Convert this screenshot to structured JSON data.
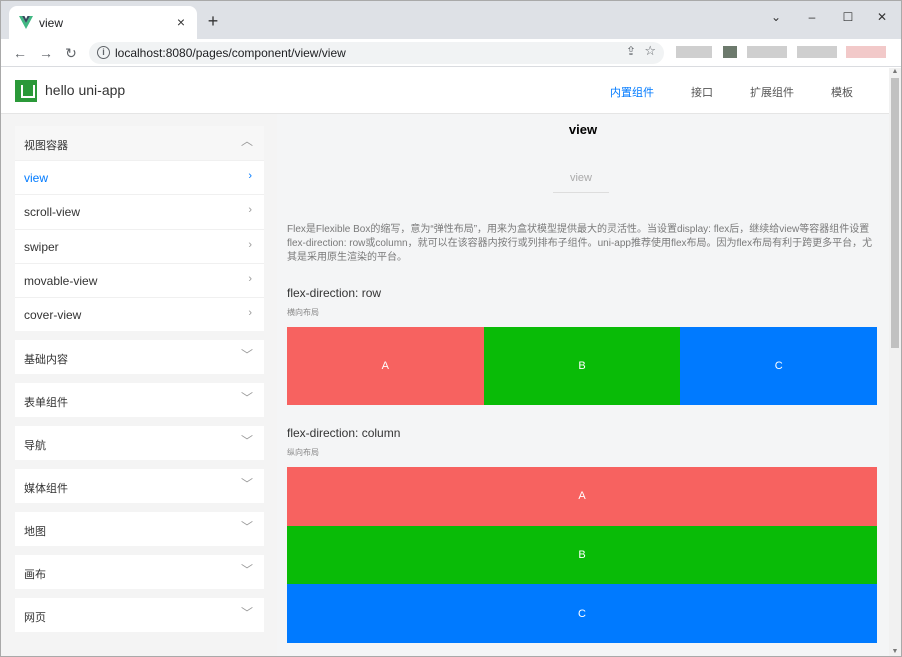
{
  "browser": {
    "tab_title": "view",
    "tab_close": "×",
    "new_tab": "+",
    "win_minimize": "–",
    "win_maximize": "☐",
    "win_close": "✕",
    "win_dropdown": "⌄",
    "url": "localhost:8080/pages/component/view/view",
    "back": "←",
    "forward": "→",
    "reload": "↻"
  },
  "app": {
    "title": "hello uni-app",
    "logo_color": "#2b9939",
    "nav": [
      {
        "label": "内置组件",
        "active": true
      },
      {
        "label": "接口",
        "active": false
      },
      {
        "label": "扩展组件",
        "active": false
      },
      {
        "label": "模板",
        "active": false
      }
    ]
  },
  "sidebar": {
    "expanded_group": {
      "label": "视图容器",
      "items": [
        {
          "label": "view",
          "active": true
        },
        {
          "label": "scroll-view",
          "active": false
        },
        {
          "label": "swiper",
          "active": false
        },
        {
          "label": "movable-view",
          "active": false
        },
        {
          "label": "cover-view",
          "active": false
        }
      ]
    },
    "groups": [
      {
        "label": "基础内容"
      },
      {
        "label": "表单组件"
      },
      {
        "label": "导航"
      },
      {
        "label": "媒体组件"
      },
      {
        "label": "地图"
      },
      {
        "label": "画布"
      },
      {
        "label": "网页"
      }
    ]
  },
  "content": {
    "page_title": "view",
    "view_label": "view",
    "description": "Flex是Flexible Box的缩写，意为“弹性布局”，用来为盒状模型提供最大的灵活性。当设置display: flex后，继续给view等容器组件设置flex-direction: row或column，就可以在该容器内按行或列排布子组件。uni-app推荐使用flex布局。因为flex布局有利于跨更多平台，尤其是采用原生渲染的平台。",
    "row_section": {
      "title": "flex-direction: row",
      "subtitle": "横向布局"
    },
    "column_section": {
      "title": "flex-direction: column",
      "subtitle": "纵向布局"
    },
    "boxes": [
      {
        "label": "A",
        "color": "#f76260"
      },
      {
        "label": "B",
        "color": "#09bb07"
      },
      {
        "label": "C",
        "color": "#007aff"
      }
    ]
  },
  "colors": {
    "accent": "#007aff",
    "box_a": "#f76260",
    "box_b": "#09bb07",
    "box_c": "#007aff"
  }
}
